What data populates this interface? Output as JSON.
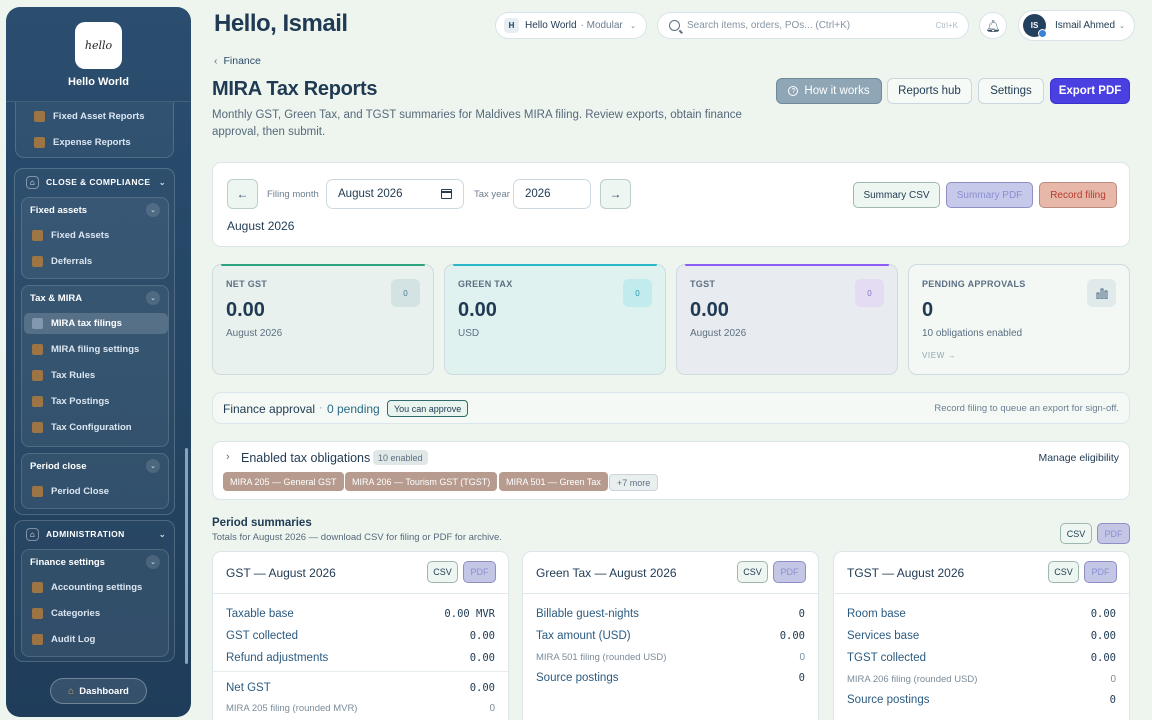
{
  "sidebar": {
    "logo_text": "hello",
    "brand": "Hello World",
    "top_items": [
      "Fixed Asset Reports",
      "Expense Reports"
    ],
    "close": {
      "title": "CLOSE & COMPLIANCE",
      "fixed_assets": {
        "title": "Fixed assets",
        "items": [
          "Fixed Assets",
          "Deferrals"
        ]
      },
      "tax": {
        "title": "Tax & MIRA",
        "items": [
          "MIRA tax filings",
          "MIRA filing settings",
          "Tax Rules",
          "Tax Postings",
          "Tax Configuration"
        ]
      },
      "period": {
        "title": "Period close",
        "items": [
          "Period Close"
        ]
      }
    },
    "admin": {
      "title": "ADMINISTRATION",
      "finance": {
        "title": "Finance settings",
        "items": [
          "Accounting settings",
          "Categories",
          "Audit Log"
        ]
      }
    },
    "dashboard": "Dashboard"
  },
  "header": {
    "greeting": "Hello, Ismail",
    "workspace_badge": "H",
    "workspace": "Hello World",
    "workspace_org": "· Modular",
    "search_placeholder": "Search items, orders, POs... (Ctrl+K)",
    "search_kbd": "Ctrl+K",
    "user_initials": "IS",
    "user_name": "Ismail Ahmed"
  },
  "page": {
    "breadcrumb": "Finance",
    "title": "MIRA Tax Reports",
    "subtitle": "Monthly GST, Green Tax, and TGST summaries for Maldives MIRA filing. Review exports, obtain finance approval, then submit.",
    "actions": {
      "how": "How it works",
      "hub": "Reports hub",
      "settings": "Settings",
      "export": "Export PDF"
    }
  },
  "filing": {
    "prev": "←",
    "next": "→",
    "month_label": "Filing month",
    "month_value": "August 2026",
    "year_label": "Tax year",
    "year_value": "2026",
    "summary_csv": "Summary CSV",
    "summary_pdf": "Summary PDF",
    "record": "Record filing",
    "period_text": "August 2026"
  },
  "stats": [
    {
      "label": "NET GST",
      "value": "0.00",
      "sub": "August 2026",
      "icon": "0"
    },
    {
      "label": "GREEN TAX",
      "value": "0.00",
      "sub": "USD",
      "icon": "0"
    },
    {
      "label": "TGST",
      "value": "0.00",
      "sub": "August 2026",
      "icon": "0"
    },
    {
      "label": "PENDING APPROVALS",
      "value": "0",
      "sub": "10 obligations enabled",
      "link": "VIEW →"
    }
  ],
  "approval": {
    "title": "Finance approval",
    "sep": "·",
    "pending": "0 pending",
    "tag": "You can approve",
    "hint": "Record filing to queue an export for sign-off."
  },
  "obligations": {
    "title": "Enabled tax obligations",
    "count": "10 enabled",
    "manage": "Manage eligibility",
    "chips": [
      "MIRA 205 — General GST",
      "MIRA 206 — Tourism GST (TGST)",
      "MIRA 501 — Green Tax"
    ],
    "more": "+7 more"
  },
  "summaries": {
    "title": "Period summaries",
    "subtitle": "Totals for August 2026 — download CSV for filing or PDF for archive.",
    "csv": "CSV",
    "pdf": "PDF",
    "cards": [
      {
        "title": "GST — August 2026",
        "rows": [
          {
            "k": "Taxable base",
            "v": "0.00 MVR"
          },
          {
            "k": "GST collected",
            "v": "0.00"
          },
          {
            "k": "Refund adjustments",
            "v": "0.00"
          },
          {
            "k": "Net GST",
            "v": "0.00"
          },
          {
            "k": "MIRA 205 filing (rounded MVR)",
            "v": "0"
          }
        ]
      },
      {
        "title": "Green Tax — August 2026",
        "rows": [
          {
            "k": "Billable guest-nights",
            "v": "0"
          },
          {
            "k": "Tax amount (USD)",
            "v": "0.00"
          },
          {
            "k": "MIRA 501 filing (rounded USD)",
            "v": "0"
          },
          {
            "k": "Source postings",
            "v": "0"
          }
        ]
      },
      {
        "title": "TGST — August 2026",
        "rows": [
          {
            "k": "Room base",
            "v": "0.00"
          },
          {
            "k": "Services base",
            "v": "0.00"
          },
          {
            "k": "TGST collected",
            "v": "0.00"
          },
          {
            "k": "MIRA 206 filing (rounded USD)",
            "v": "0"
          },
          {
            "k": "Source postings",
            "v": "0"
          }
        ]
      }
    ]
  },
  "colors": {
    "accent": "#4a3fe0",
    "sidebar": "#244563",
    "gst_bar": "#2fa37f",
    "green_bar": "#2cb7c9",
    "tgst_bar": "#8b5cf6"
  }
}
